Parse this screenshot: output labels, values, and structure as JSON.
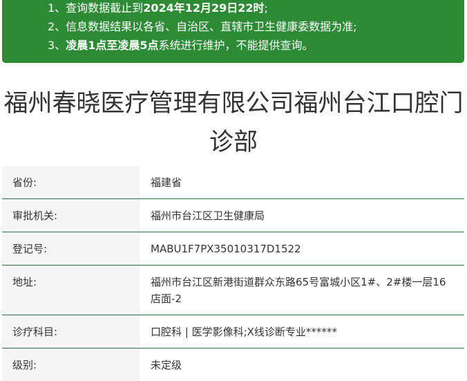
{
  "notice": {
    "line1_prefix": "1、查询数据截止到",
    "line1_bold": "2024年12月29日22时",
    "line1_suffix": ";",
    "line2": "2、信息数据结果以各省、自治区、直辖市卫生健康委数据为准;",
    "line3_prefix": "3、",
    "line3_bold": "凌晨1点至凌晨5点",
    "line3_suffix": "系统进行维护，不能提供查询。",
    "bg_color": "#2e8b35"
  },
  "title": "福州春晓医疗管理有限公司福州台江口腔门诊部",
  "rows": [
    {
      "label": "省份:",
      "value": "福建省"
    },
    {
      "label": "审批机关:",
      "value": "福州市台江区卫生健康局"
    },
    {
      "label": "登记号:",
      "value": "MABU1F7PX35010317D1522"
    },
    {
      "label": "地址:",
      "value": "福州市台江区新港街道群众东路65号富城小区1#、2#楼一层16店面-2"
    },
    {
      "label": "诊疗科目:",
      "value": "口腔科 | 医学影像科;X线诊断专业******"
    },
    {
      "label": "级别:",
      "value": "未定级"
    }
  ]
}
